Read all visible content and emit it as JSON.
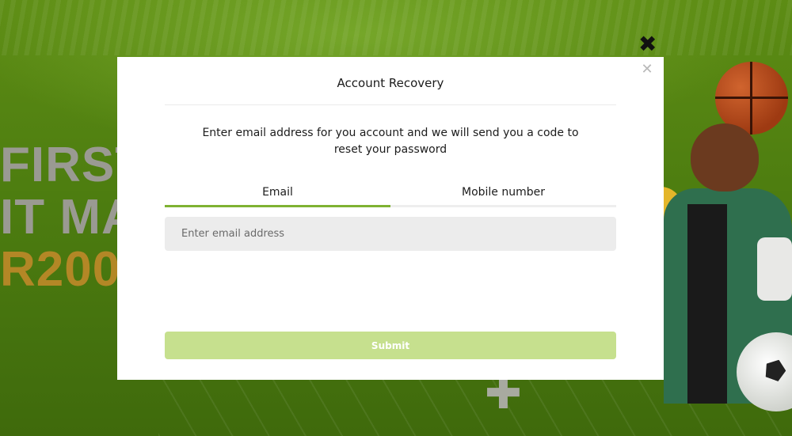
{
  "background": {
    "promo_lines": [
      "FIRST",
      "IT MA",
      "R200"
    ],
    "accent_color": "#7fb232"
  },
  "icons": {
    "outer_close": "✖",
    "modal_close": "✕",
    "plus": "✚"
  },
  "modal": {
    "title": "Account Recovery",
    "description": "Enter email address for you account and we will send you a code to reset your password",
    "tabs": [
      {
        "label": "Email",
        "active": true
      },
      {
        "label": "Mobile number",
        "active": false
      }
    ],
    "email_placeholder": "Enter email address",
    "submit_label": "Submit",
    "submit_color": "#c6e08e"
  }
}
